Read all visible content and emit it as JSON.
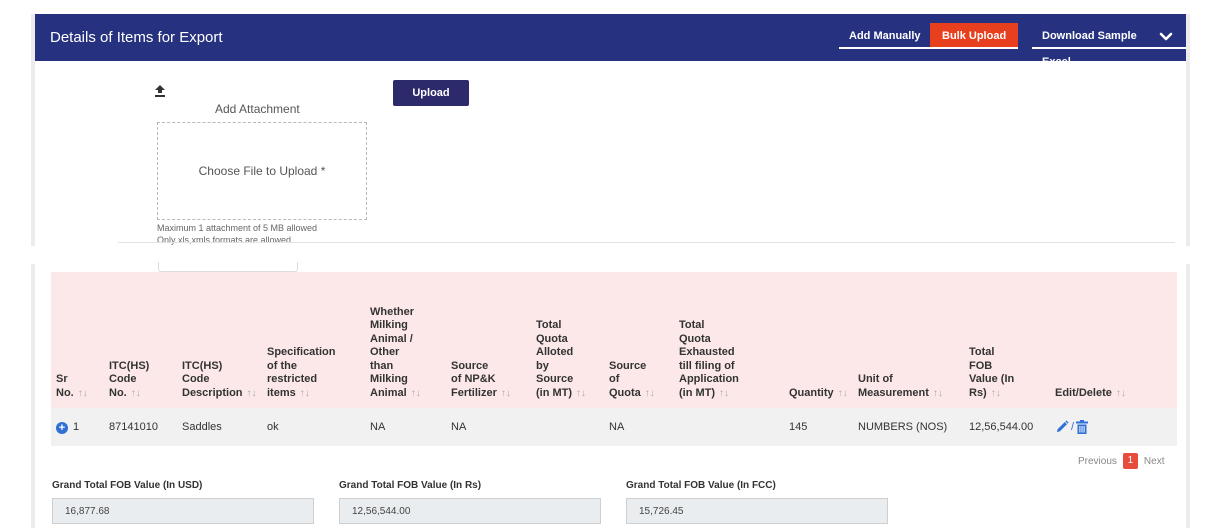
{
  "header": {
    "title": "Details of Items for Export",
    "add_manually": "Add Manually",
    "bulk_upload": "Bulk Upload",
    "download_sample": "Download Sample Excel"
  },
  "upload": {
    "attach_label": "Add Attachment",
    "button": "Upload",
    "dropzone_text": "Choose File to Upload *",
    "hint_size": "Maximum 1 attachment of 5 MB allowed",
    "hint_format": "Only xls,xmls formats are allowed."
  },
  "table": {
    "columns": [
      [
        "Sr",
        "No."
      ],
      [
        "ITC(HS)",
        "Code",
        "No."
      ],
      [
        "ITC(HS)",
        "Code",
        "Description"
      ],
      [
        "Specification",
        "of the",
        "restricted",
        "items"
      ],
      [
        "Whether",
        "Milking",
        "Animal /",
        "Other",
        "than",
        "Milking",
        "Animal"
      ],
      [
        "Source",
        "of NP&K",
        "Fertilizer"
      ],
      [
        "Total",
        "Quota",
        "Alloted",
        "by",
        "Source",
        "(in MT)"
      ],
      [
        "Source",
        "of",
        "Quota"
      ],
      [
        "Total",
        "Quota",
        "Exhausted",
        "till filing of",
        "Application",
        "(in MT)"
      ],
      [
        "Quantity"
      ],
      [
        "Unit of",
        "Measurement"
      ],
      [
        "Total",
        "FOB",
        "Value (In",
        "Rs)"
      ],
      [
        "Edit/Delete"
      ]
    ],
    "rows": [
      {
        "sr": "1",
        "itc_code": "87141010",
        "description": "Saddles",
        "specification": "ok",
        "milking_animal": "NA",
        "npk_source": "NA",
        "quota_alloted": "",
        "quota_source": "NA",
        "quota_exhausted": "",
        "quantity": "145",
        "unit": "NUMBERS (NOS)",
        "fob_value": "12,56,544.00"
      }
    ]
  },
  "pagination": {
    "previous": "Previous",
    "current": "1",
    "next": "Next"
  },
  "totals": {
    "usd_label": "Grand Total FOB Value (In USD)",
    "usd_value": "16,877.68",
    "rs_label": "Grand Total FOB Value (In Rs)",
    "rs_value": "12,56,544.00",
    "fcc_label": "Grand Total FOB Value (In FCC)",
    "fcc_value": "15,726.45"
  },
  "colors": {
    "header_bg": "#26327f",
    "bulk_upload_bg": "#e8401e",
    "upload_button_bg": "#2c2a6b",
    "table_header_bg": "#fce8e8",
    "active_page_bg": "#e74c3c"
  },
  "icons": [
    "chevron-down-icon",
    "upload-icon",
    "expand-plus-icon",
    "edit-pencil-icon",
    "trash-icon",
    "sort-icon"
  ]
}
